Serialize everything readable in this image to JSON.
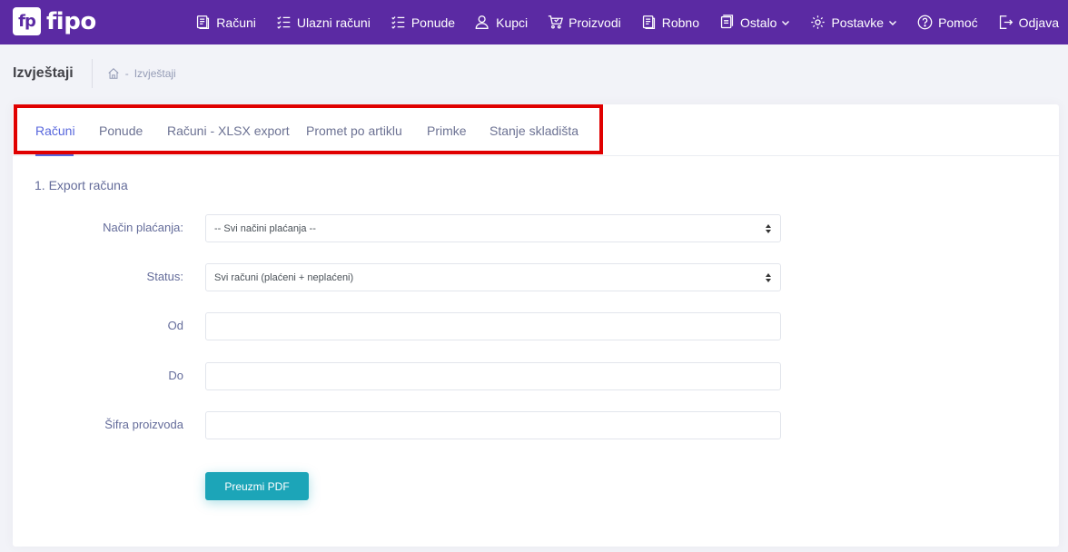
{
  "app": {
    "logo_badge": "fp",
    "logo_text": "fipo"
  },
  "nav": {
    "items": [
      {
        "label": "Računi",
        "icon": "invoice-icon"
      },
      {
        "label": "Ulazni računi",
        "icon": "checklist-icon"
      },
      {
        "label": "Ponude",
        "icon": "checklist-icon"
      },
      {
        "label": "Kupci",
        "icon": "user-icon"
      },
      {
        "label": "Proizvodi",
        "icon": "cart-icon"
      },
      {
        "label": "Robno",
        "icon": "invoice-icon"
      },
      {
        "label": "Ostalo",
        "icon": "stack-icon",
        "dropdown": true
      },
      {
        "label": "Postavke",
        "icon": "gear-icon",
        "dropdown": true
      },
      {
        "label": "Pomoć",
        "icon": "help-icon"
      },
      {
        "label": "Odjava",
        "icon": "logout-icon"
      }
    ]
  },
  "subheader": {
    "title": "Izvještaji",
    "breadcrumb": "Izvještaji",
    "home_icon": "home-icon"
  },
  "tabs": [
    "Računi",
    "Ponude",
    "Računi - XLSX export",
    "Promet po artiklu",
    "Primke",
    "Stanje skladišta"
  ],
  "active_tab": "Računi",
  "section_title": "1. Export računa",
  "form": {
    "payment_label": "Način plaćanja:",
    "payment_value": "-- Svi načini plaćanja --",
    "status_label": "Status:",
    "status_value": "Svi računi (plaćeni + neplaćeni)",
    "from_label": "Od",
    "from_value": "",
    "to_label": "Do",
    "to_value": "",
    "sku_label": "Šifra proizvoda",
    "sku_value": "",
    "submit_label": "Preuzmi PDF"
  },
  "colors": {
    "brand": "#5b2aa3",
    "accent": "#5867dd",
    "button": "#1ca5b8",
    "highlight": "#e00000"
  }
}
